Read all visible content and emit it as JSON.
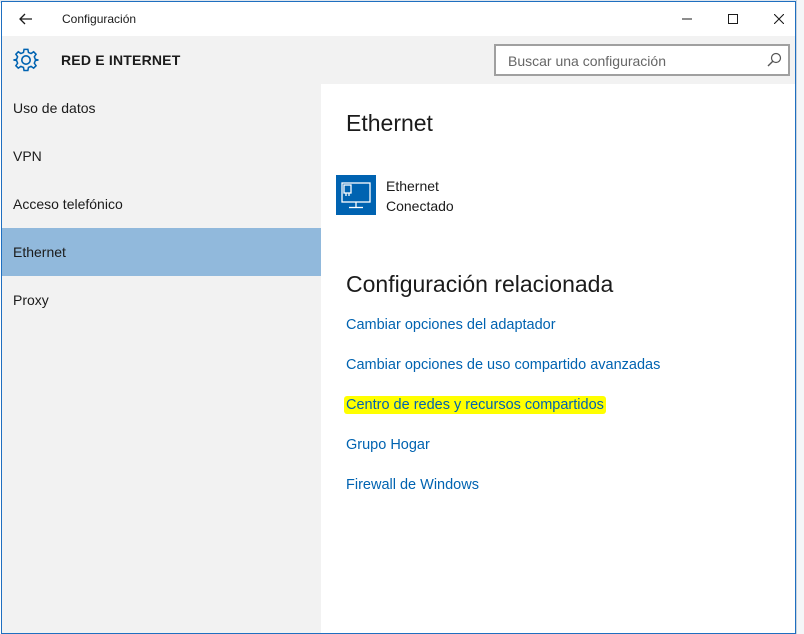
{
  "window": {
    "title": "Configuración"
  },
  "header": {
    "section_title": "RED E INTERNET",
    "search_placeholder": "Buscar una configuración"
  },
  "sidebar": {
    "items": [
      {
        "label": "Uso de datos",
        "selected": false
      },
      {
        "label": "VPN",
        "selected": false
      },
      {
        "label": "Acceso telefónico",
        "selected": false
      },
      {
        "label": "Ethernet",
        "selected": true
      },
      {
        "label": "Proxy",
        "selected": false
      }
    ]
  },
  "main": {
    "title": "Ethernet",
    "connection": {
      "name": "Ethernet",
      "status": "Conectado",
      "icon": "ethernet-monitor-icon"
    },
    "related_title": "Configuración relacionada",
    "links": [
      {
        "label": "Cambiar opciones del adaptador",
        "highlighted": false
      },
      {
        "label": "Cambiar opciones de uso compartido avanzadas",
        "highlighted": false
      },
      {
        "label": "Centro de redes y recursos compartidos",
        "highlighted": true
      },
      {
        "label": "Grupo Hogar",
        "highlighted": false
      },
      {
        "label": "Firewall de Windows",
        "highlighted": false
      }
    ]
  },
  "colors": {
    "accent": "#0063b1",
    "selection": "#91b9dc",
    "highlight": "#ffff00",
    "sidebar_bg": "#f2f2f2"
  }
}
